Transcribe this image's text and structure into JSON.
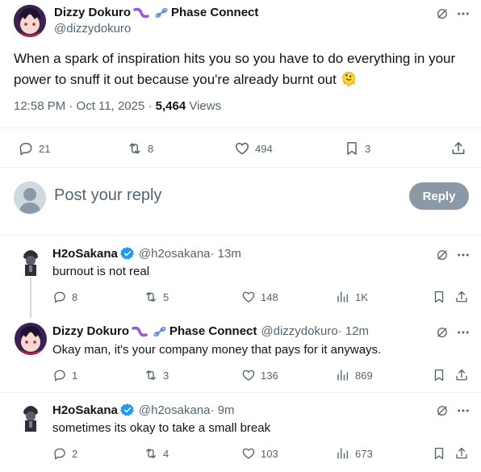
{
  "main_tweet": {
    "display_name": "Dizzy Dokuro",
    "affiliation": "Phase Connect",
    "handle": "@dizzydokuro",
    "text": "When a spark of inspiration hits you so you have to do everything in your power to snuff it out because you're already burnt out",
    "emoji": "🫠",
    "time": "12:58 PM · Oct 11, 2025 · ",
    "views_count": "5,464",
    "views_label": " Views",
    "replies": "21",
    "reposts": "8",
    "likes": "494",
    "bookmarks": "3"
  },
  "reply_box": {
    "placeholder": "Post your reply",
    "button_label": "Reply"
  },
  "replies": [
    {
      "display_name": "H2oSakana",
      "handle": "@h2osakana",
      "time": " · 13m",
      "text": "burnout is not real",
      "replies": "8",
      "reposts": "5",
      "likes": "148",
      "views": "1K"
    },
    {
      "display_name": "Dizzy Dokuro",
      "affiliation": "Phase Connect",
      "handle": "@dizzydokuro",
      "time": " · 12m",
      "text": "Okay man, it's your company money that pays for it anyways.",
      "replies": "1",
      "reposts": "3",
      "likes": "136",
      "views": "869"
    },
    {
      "display_name": "H2oSakana",
      "handle": "@h2osakana",
      "time": " · 9m",
      "text": "sometimes its okay to take a small break",
      "replies": "2",
      "reposts": "4",
      "likes": "103",
      "views": "673"
    }
  ],
  "colors": {
    "accent": "#1d9bf0",
    "muted": "#536471",
    "reply_button": "#8b98a5",
    "divider": "#eff3f4"
  },
  "icons": [
    "grok-icon",
    "more-icon",
    "reply-icon",
    "repost-icon",
    "like-icon",
    "bookmark-icon",
    "share-icon",
    "views-icon",
    "verified-icon",
    "avatar-placeholder-icon"
  ]
}
